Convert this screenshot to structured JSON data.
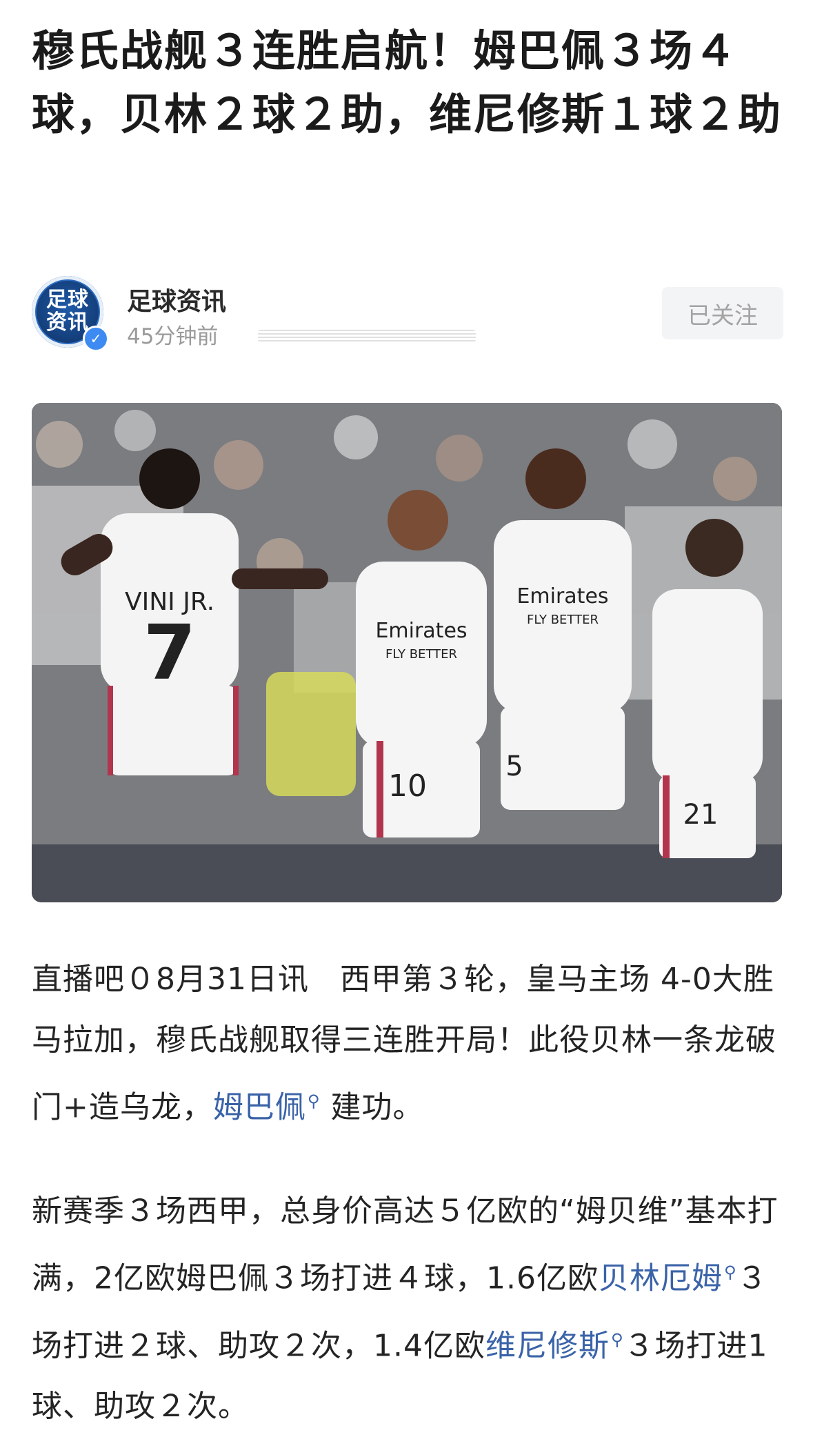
{
  "article": {
    "title": "穆氏战舰３连胜启航！姆巴佩３场４球，贝林２球２助，维尼修斯１球２助"
  },
  "author": {
    "avatar_text": "足球资讯",
    "name": "足球资讯",
    "time": "45分钟前",
    "follow_label": "已关注"
  },
  "photo": {
    "jersey_names": {
      "vini": "VINI JR."
    },
    "numbers": {
      "vini": "7",
      "mbappe": "10",
      "bellingham": "5",
      "brahim": "21"
    },
    "sponsor": "Emirates",
    "sponsor_tagline": "FLY BETTER"
  },
  "paragraphs": {
    "p1": {
      "text_before": "直播吧０8月31日讯　西甲第３轮，皇马主场 4-0大胜马拉加，穆氏战舰取得三连胜开局！此役贝林一条龙破门+造乌龙，",
      "link1": "姆巴佩",
      "text_after": "建功。"
    },
    "p2": {
      "text_a": "新赛季３场西甲，总身价高达５亿欧的“姆贝维”基本打满，2亿欧姆巴佩３场打进４球，1.6亿欧",
      "link1": "贝林厄姆",
      "text_b": "３场打进２球、助攻２次，1.4亿欧",
      "link2": "维尼修斯",
      "text_c": "３场打进1球、助攻２次。"
    },
    "link_icon": "search-icon"
  }
}
